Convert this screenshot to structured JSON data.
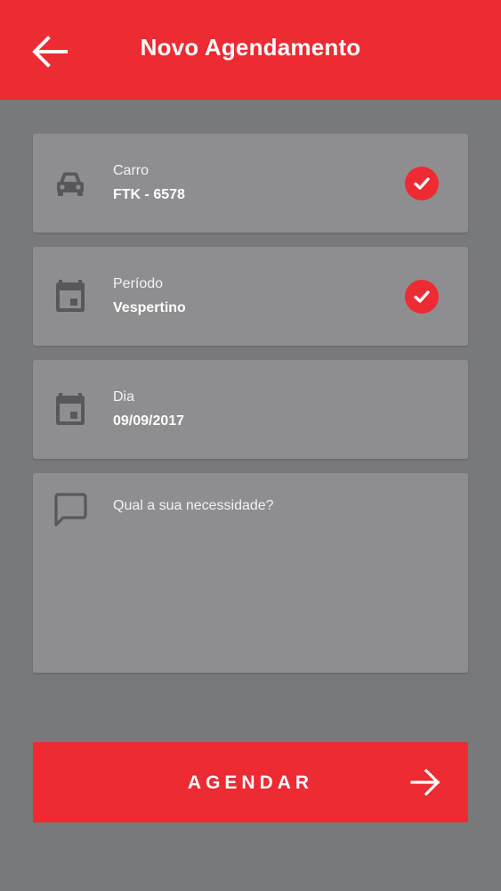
{
  "header": {
    "title": "Novo Agendamento",
    "back_icon": "arrow-left-icon"
  },
  "fields": {
    "car": {
      "label": "Carro",
      "value": "FTK - 6578",
      "icon": "car-icon",
      "selected": true
    },
    "period": {
      "label": "Período",
      "value": "Vespertino",
      "icon": "calendar-icon",
      "selected": true
    },
    "day": {
      "label": "Dia",
      "value": "09/09/2017",
      "icon": "calendar-icon",
      "selected": false
    }
  },
  "need": {
    "placeholder": "Qual a sua necessidade?",
    "value": "",
    "icon": "message-icon"
  },
  "submit": {
    "label": "AGENDAR",
    "icon": "arrow-right-icon"
  },
  "colors": {
    "accent": "#ee2a32",
    "background": "#78797b",
    "card": "#8e8e91",
    "icon": "#58585b"
  }
}
